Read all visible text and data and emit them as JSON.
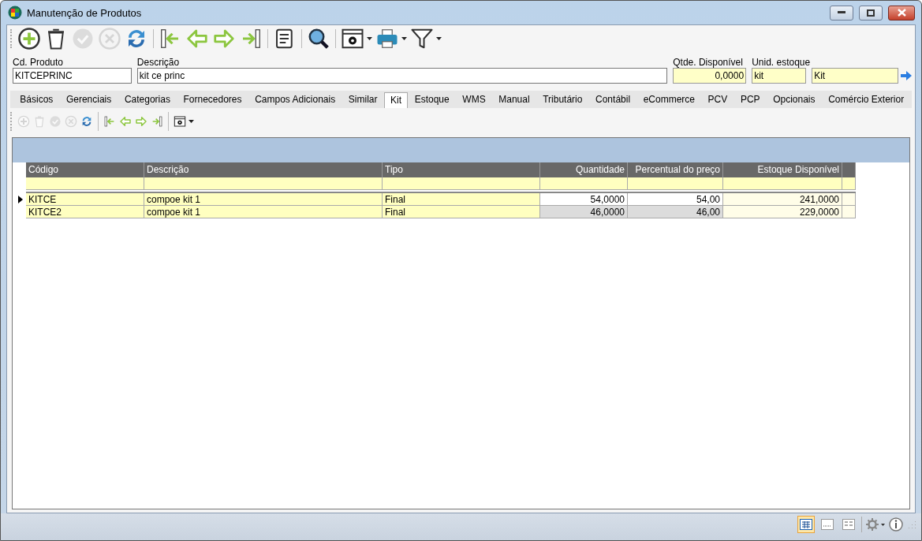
{
  "window": {
    "title": "Manutenção de Produtos"
  },
  "toolbar": [
    {
      "kind": "add",
      "disabled": false
    },
    {
      "kind": "delete",
      "disabled": false
    },
    {
      "kind": "confirm",
      "disabled": true
    },
    {
      "kind": "cancel",
      "disabled": true
    },
    {
      "kind": "refresh",
      "disabled": false
    },
    {
      "kind": "separator"
    },
    {
      "kind": "first",
      "disabled": false
    },
    {
      "kind": "prev",
      "disabled": false
    },
    {
      "kind": "next",
      "disabled": false
    },
    {
      "kind": "last",
      "disabled": false
    },
    {
      "kind": "separator"
    },
    {
      "kind": "report",
      "disabled": false
    },
    {
      "kind": "separator"
    },
    {
      "kind": "search",
      "disabled": false
    },
    {
      "kind": "separator"
    },
    {
      "kind": "settings",
      "disabled": false
    },
    {
      "kind": "print",
      "disabled": false
    },
    {
      "kind": "filter",
      "disabled": false
    }
  ],
  "fields": [
    {
      "label": "Cd. Produto",
      "value": "KITCEPRINC",
      "readonly": false,
      "kind": "text"
    },
    {
      "label": "Descrição",
      "value": "kit ce princ",
      "readonly": false,
      "kind": "text"
    },
    {
      "label": "Qtde. Disponível",
      "value": "0,0000",
      "readonly": true,
      "kind": "number"
    },
    {
      "label": "Unid. estoque",
      "value": "kit",
      "readonly": true,
      "kind": "text"
    },
    {
      "value": "Kit",
      "readonly": true,
      "kind": "text"
    }
  ],
  "tabs": [
    {
      "label": "Básicos",
      "selected": false
    },
    {
      "label": "Gerenciais",
      "selected": false
    },
    {
      "label": "Categorias",
      "selected": false
    },
    {
      "label": "Fornecedores",
      "selected": false
    },
    {
      "label": "Campos Adicionais",
      "selected": false
    },
    {
      "label": "Similar",
      "selected": false
    },
    {
      "label": "Kit",
      "selected": true
    },
    {
      "label": "Estoque",
      "selected": false
    },
    {
      "label": "WMS",
      "selected": false
    },
    {
      "label": "Manual",
      "selected": false
    },
    {
      "label": "Tributário",
      "selected": false
    },
    {
      "label": "Contábil",
      "selected": false
    },
    {
      "label": "eCommerce",
      "selected": false
    },
    {
      "label": "PCV",
      "selected": false
    },
    {
      "label": "PCP",
      "selected": false
    },
    {
      "label": "Opcionais",
      "selected": false
    },
    {
      "label": "Comércio Exterior",
      "selected": false
    }
  ],
  "subtoolbar": [
    {
      "kind": "add",
      "disabled": true
    },
    {
      "kind": "delete",
      "disabled": true
    },
    {
      "kind": "confirm",
      "disabled": true
    },
    {
      "kind": "cancel",
      "disabled": true
    },
    {
      "kind": "refresh",
      "disabled": false
    },
    {
      "kind": "separator"
    },
    {
      "kind": "first",
      "disabled": false
    },
    {
      "kind": "prev",
      "disabled": false
    },
    {
      "kind": "next",
      "disabled": false
    },
    {
      "kind": "last",
      "disabled": false
    },
    {
      "kind": "separator"
    },
    {
      "kind": "settings",
      "disabled": false
    }
  ],
  "table": {
    "columns": [
      {
        "label": "Código",
        "kind": "text"
      },
      {
        "label": "Descrição",
        "kind": "text"
      },
      {
        "label": "Tipo",
        "kind": "text"
      },
      {
        "label": "Quantidade",
        "kind": "editable"
      },
      {
        "label": "Percentual do preço",
        "kind": "editable"
      },
      {
        "label": "Estoque Disponível",
        "kind": "computed"
      }
    ],
    "rows": [
      {
        "selected": true,
        "cells": [
          "KITCE",
          "compoe kit 1",
          "Final",
          "54,0000",
          "54,00",
          "241,0000"
        ]
      },
      {
        "selected": false,
        "cells": [
          "KITCE2",
          "compoe kit 1",
          "Final",
          "46,0000",
          "46,00",
          "229,0000"
        ]
      }
    ]
  },
  "status_bar": {
    "views": [
      {
        "kind": "grid",
        "selected": true
      },
      {
        "kind": "list",
        "selected": false
      },
      {
        "kind": "form",
        "selected": false
      }
    ]
  }
}
